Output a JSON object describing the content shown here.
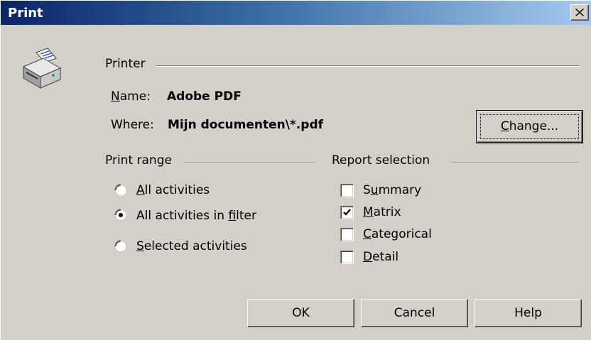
{
  "window": {
    "title": "Print",
    "close_glyph": "✕"
  },
  "printer": {
    "group_label": "Printer",
    "name_label": "Name:",
    "name_value": "Adobe PDF",
    "where_label": "Where:",
    "where_value": "Mijn documenten\\*.pdf",
    "change_button": "Change...",
    "icon": "printer-icon"
  },
  "print_range": {
    "group_label": "Print range",
    "options": [
      {
        "label": "All activities",
        "selected": false
      },
      {
        "label": "All activities in filter",
        "selected": true
      },
      {
        "label": "Selected activities",
        "selected": false
      }
    ]
  },
  "report_selection": {
    "group_label": "Report selection",
    "options": [
      {
        "label": "Summary",
        "checked": false
      },
      {
        "label": "Matrix",
        "checked": true
      },
      {
        "label": "Categorical",
        "checked": false
      },
      {
        "label": "Detail",
        "checked": false
      }
    ]
  },
  "buttons": {
    "ok": "OK",
    "cancel": "Cancel",
    "help": "Help"
  },
  "colors": {
    "dialog_face": "#d4d0c8",
    "title_start": "#0a246a",
    "title_end": "#a6caf0"
  }
}
